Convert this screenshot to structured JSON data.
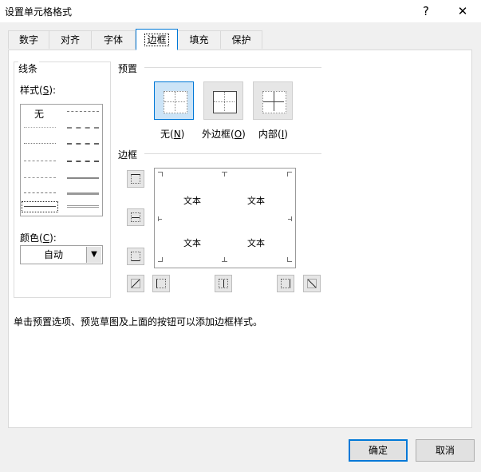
{
  "window": {
    "title": "设置单元格格式",
    "help": "?",
    "close": "✕"
  },
  "tabs": [
    "数字",
    "对齐",
    "字体",
    "边框",
    "填充",
    "保护"
  ],
  "line": {
    "group_label": "线条",
    "style_label": "样式(",
    "style_key": "S",
    "style_suffix": "):",
    "none_label": "无",
    "color_label": "颜色(",
    "color_key": "C",
    "color_suffix": "):",
    "color_value": "自动"
  },
  "presets": {
    "group_label": "预置",
    "items": [
      {
        "label": "无(",
        "key": "N",
        "suffix": ")"
      },
      {
        "label": "外边框(",
        "key": "O",
        "suffix": ")"
      },
      {
        "label": "内部(",
        "key": "I",
        "suffix": ")"
      }
    ]
  },
  "border": {
    "group_label": "边框",
    "cell_text": [
      "文本",
      "文本",
      "文本",
      "文本"
    ]
  },
  "hint": "单击预置选项、预览草图及上面的按钮可以添加边框样式。",
  "buttons": {
    "ok": "确定",
    "cancel": "取消"
  },
  "colors": {
    "accent": "#0078d7",
    "selected_fill": "#cce4f7"
  }
}
